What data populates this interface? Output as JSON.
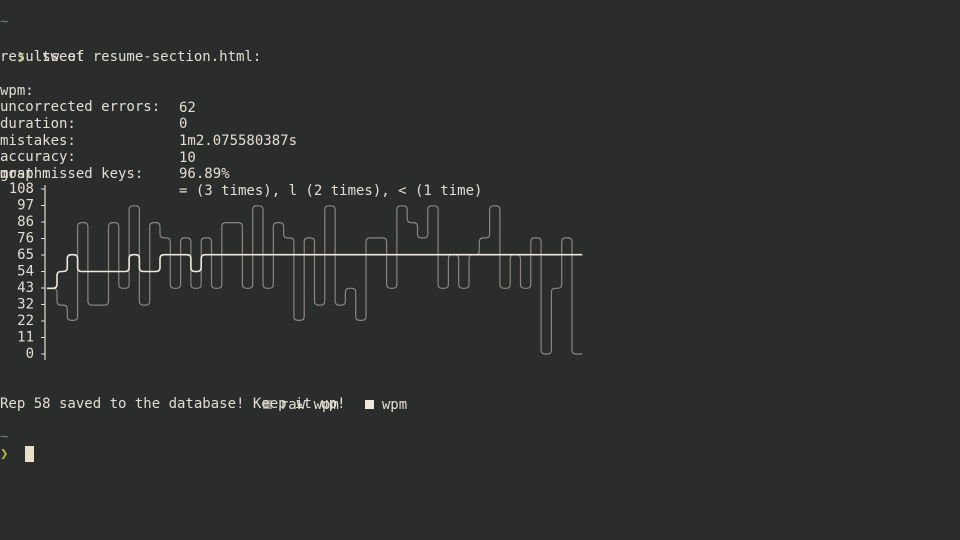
{
  "terminal": {
    "cwd_top": "~",
    "prompt_glyph": "❯",
    "command": "sweet",
    "results_header": "results of resume-section.html:",
    "stats": [
      {
        "label": "wpm:",
        "value": "62"
      },
      {
        "label": "uncorrected errors:",
        "value": "0"
      },
      {
        "label": "duration:",
        "value": "1m2.075580387s"
      },
      {
        "label": "mistakes:",
        "value": "10"
      },
      {
        "label": "accuracy:",
        "value": "96.89%"
      },
      {
        "label": "most missed keys:",
        "value": "= (3 times), l (2 times), < (1 time)"
      }
    ],
    "graph_label": "graph:",
    "saved_message": "Rep 58 saved to the database! Keep it up!",
    "cwd_bottom": "~"
  },
  "colors": {
    "background": "#2b2c2c",
    "text": "#e3ded3",
    "raw_wpm": "#8a8580",
    "wpm": "#efe9dc",
    "prompt_glyph": "#b6b84a",
    "dim_path": "#5e8a7c"
  },
  "chart_data": {
    "type": "line",
    "y_ticks": [
      "108",
      "97",
      "86",
      "76",
      "65",
      "54",
      "43",
      "32",
      "22",
      "11",
      "0"
    ],
    "ylim": [
      0,
      108
    ],
    "series": [
      {
        "name": "raw wpm",
        "values": [
          43,
          32,
          22,
          86,
          32,
          32,
          86,
          43,
          97,
          32,
          86,
          76,
          43,
          76,
          43,
          76,
          43,
          86,
          86,
          43,
          97,
          43,
          86,
          76,
          22,
          76,
          32,
          97,
          32,
          43,
          22,
          76,
          76,
          43,
          97,
          86,
          76,
          97,
          43,
          65,
          43,
          65,
          76,
          97,
          43,
          65,
          43,
          76,
          0,
          43,
          76,
          0
        ]
      },
      {
        "name": "wpm",
        "values": [
          43,
          54,
          65,
          54,
          54,
          54,
          54,
          54,
          65,
          54,
          54,
          65,
          65,
          65,
          54,
          65,
          65,
          65,
          65,
          65,
          65,
          65,
          65,
          65,
          65,
          65,
          65,
          65,
          65,
          65,
          65,
          65,
          65,
          65,
          65,
          65,
          65,
          65,
          65,
          65,
          65,
          65,
          65,
          65,
          65,
          65,
          65,
          65,
          65,
          65,
          65,
          65
        ]
      }
    ],
    "legend": [
      "raw wpm",
      "wpm"
    ],
    "legend_position": "bottom"
  }
}
